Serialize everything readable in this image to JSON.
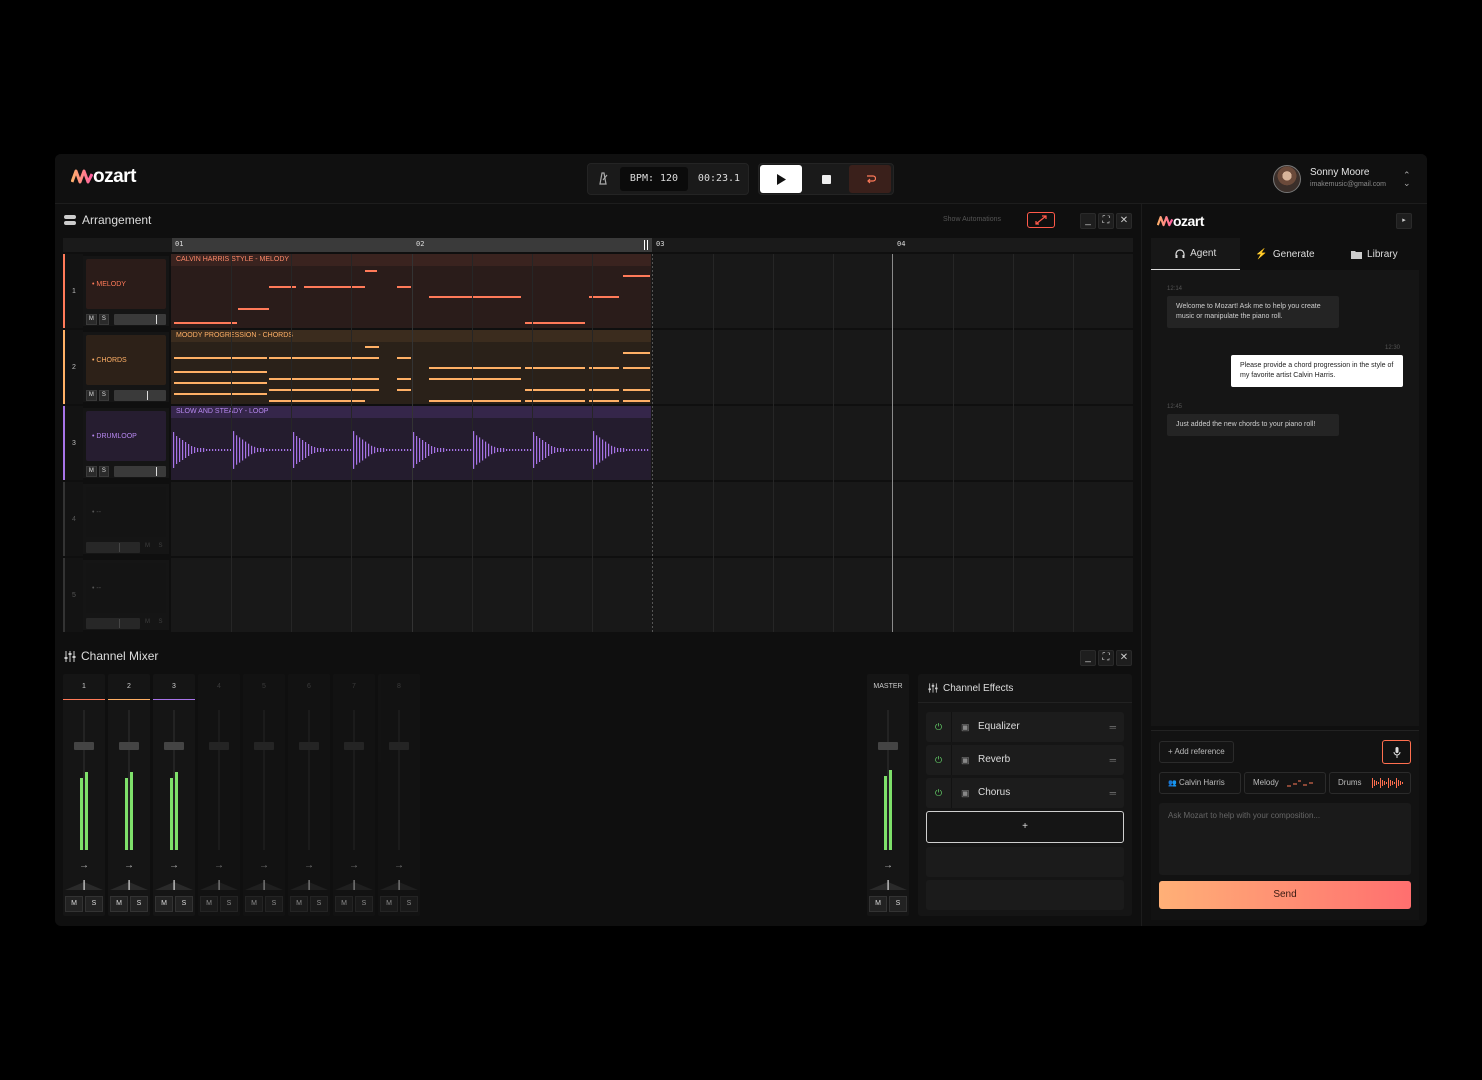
{
  "app": {
    "logo_text": "ozart",
    "colors": {
      "accent": "#ff7a59",
      "melody": "#ff7a59",
      "chords": "#ffb066",
      "drums": "#a774e8",
      "meter": "#7ee06a"
    }
  },
  "transport": {
    "bpm": "BPM: 120",
    "time": "00:23.1",
    "play_icon": "play-icon",
    "stop_icon": "stop-icon",
    "loop_icon": "loop-icon"
  },
  "user": {
    "name": "Sonny Moore",
    "email": "imakemusic@gmail.com"
  },
  "arrangement": {
    "title": "Arrangement",
    "show_automations": "Show Automations",
    "bars": [
      "01",
      "02",
      "03",
      "04"
    ],
    "tracks": [
      {
        "num": "1",
        "name": "• MELODY",
        "clip": "CALVIN HARRIS STYLE - MELODY",
        "type": "melody"
      },
      {
        "num": "2",
        "name": "• CHORDS",
        "clip": "MOODY PROGRESSION - CHORDS",
        "type": "chords"
      },
      {
        "num": "3",
        "name": "• DRUMLOOP",
        "clip": "SLOW AND STEADY - LOOP",
        "type": "drums"
      },
      {
        "num": "4",
        "name": "• --",
        "clip": "",
        "type": "empty"
      },
      {
        "num": "5",
        "name": "• --",
        "clip": "",
        "type": "empty"
      }
    ],
    "m": "M",
    "s": "S"
  },
  "mixer": {
    "title": "Channel Mixer",
    "channels": [
      "1",
      "2",
      "3",
      "4",
      "5",
      "6",
      "7",
      "8"
    ],
    "master": "MASTER",
    "m": "M",
    "s": "S"
  },
  "effects": {
    "title": "Channel Effects",
    "items": [
      "Equalizer",
      "Reverb",
      "Chorus"
    ],
    "add": "+"
  },
  "agent": {
    "logo_text": "ozart",
    "tabs": [
      "Agent",
      "Generate",
      "Library"
    ],
    "messages": [
      {
        "time": "12:14",
        "text": "Welcome to Mozart! Ask me to help you create music or manipulate the piano roll.",
        "from": "agent"
      },
      {
        "time": "12:30",
        "text": "Please provide a chord progression in the style of my favorite artist Calvin Harris.",
        "from": "user"
      },
      {
        "time": "12:45",
        "text": "Just added the new chords to your piano roll!",
        "from": "agent"
      }
    ],
    "add_reference": "+ Add reference",
    "chips": [
      "Calvin Harris",
      "Melody",
      "Drums"
    ],
    "placeholder": "Ask Mozart to help with your composition...",
    "send": "Send"
  }
}
